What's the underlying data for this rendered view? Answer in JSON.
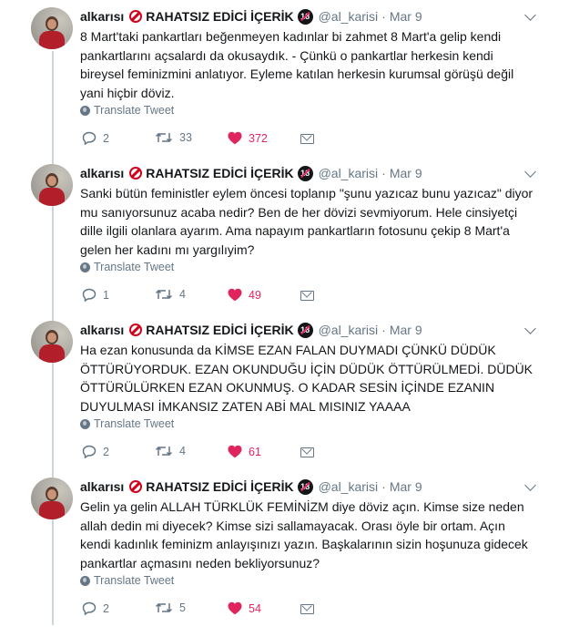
{
  "tweets": [
    {
      "name_part1": "alkarısı",
      "name_part2": "RAHATSIZ EDİCİ İÇERİK",
      "badge18": "18",
      "handle": "@al_karisi",
      "dot": "·",
      "date": "Mar 9",
      "text": "8 Mart'taki pankartları beğenmeyen kadınlar bi zahmet 8 Mart'a gelip kendi pankartlarını açsalardı da okusaydık. - Çünkü o pankartlar herkesin kendi bireysel feminizmini anlatıyor. Eyleme katılan herkesin kurumsal görüşü değil yani hiçbir döviz.",
      "translate": "Translate Tweet",
      "replies": "2",
      "retweets": "33",
      "likes": "372"
    },
    {
      "name_part1": "alkarısı",
      "name_part2": "RAHATSIZ EDİCİ İÇERİK",
      "badge18": "18",
      "handle": "@al_karisi",
      "dot": "·",
      "date": "Mar 9",
      "text": "Sanki bütün feministler eylem öncesi toplanıp \"şunu yazıcaz bunu yazıcaz\" diyor mu sanıyorsunuz acaba nedir? Ben de her dövizi sevmiyorum. Hele cinsiyetçi dille ilgili olanlara ayarım. Ama napayım pankartların fotosunu çekip 8 Mart'a gelen her kadını mı yargılıyim?",
      "translate": "Translate Tweet",
      "replies": "1",
      "retweets": "4",
      "likes": "49"
    },
    {
      "name_part1": "alkarısı",
      "name_part2": "RAHATSIZ EDİCİ İÇERİK",
      "badge18": "18",
      "handle": "@al_karisi",
      "dot": "·",
      "date": "Mar 9",
      "text": "Ha ezan konusunda da KİMSE EZAN FALAN DUYMADI ÇÜNKÜ DÜDÜK ÖTTÜRÜYORDUK. EZAN OKUNDUĞU İÇİN DÜDÜK ÖTTÜRÜLMEDİ. DÜDÜK ÖTTÜRÜLÜRKEN EZAN OKUNMUŞ. O KADAR SESİN İÇİNDE EZANIN DUYULMASI İMKANSIZ ZATEN ABİ MAL MISINIZ YAAAA",
      "translate": "Translate Tweet",
      "replies": "2",
      "retweets": "4",
      "likes": "61"
    },
    {
      "name_part1": "alkarısı",
      "name_part2": "RAHATSIZ EDİCİ İÇERİK",
      "badge18": "18",
      "handle": "@al_karisi",
      "dot": "·",
      "date": "Mar 9",
      "text": "Gelin ya gelin ALLAH TÜRKLÜK FEMİNİZM diye döviz açın. Kimse size neden allah dedin mi diyecek? Kimse sizi sallamayacak. Orası öyle bir ortam. Açın kendi kadınlık feminizm anlayışınızı yazın. Başkalarının sizin hoşunuza gidecek pankartlar açmasını neden bekliyorsunuz?",
      "translate": "Translate Tweet",
      "replies": "2",
      "retweets": "5",
      "likes": "54"
    }
  ]
}
